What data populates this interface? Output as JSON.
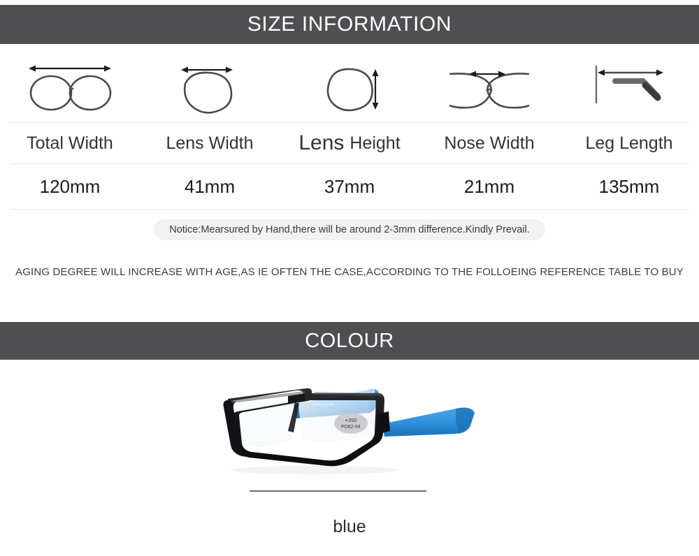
{
  "sections": {
    "size": {
      "banner_title": "SIZE INFORMATION",
      "columns": [
        {
          "icon": "total-width-icon",
          "label": "Total Width",
          "value": "120mm"
        },
        {
          "icon": "lens-width-icon",
          "label": "Lens Width",
          "value": "41mm"
        },
        {
          "icon": "lens-height-icon",
          "label_part1": "Lens",
          "label_part2": "Height",
          "label": "Lens Height",
          "value": "37mm"
        },
        {
          "icon": "nose-width-icon",
          "label": "Nose Width",
          "value": "21mm"
        },
        {
          "icon": "leg-length-icon",
          "label": "Leg Length",
          "value": "135mm"
        }
      ],
      "notice": "Notice:Mearsured by Hand,there will be around 2-3mm difference.Kindly Prevail.",
      "aging_note": "AGING DEGREE WILL INCREASE WITH AGE,AS IE OFTEN THE CASE,ACCORDING TO THE FOLLOEING REFERENCE TABLE TO BUY"
    },
    "colour": {
      "banner_title": "COLOUR",
      "product_image": "eyeglasses-photo",
      "lens_sticker_line1": "+350",
      "lens_sticker_line2": "PD62-64",
      "swatch_name": "blue"
    }
  },
  "colors": {
    "banner_background": "#4f4f51",
    "banner_text": "#ffffff",
    "rule": "#e6e6e6",
    "notice_background": "#f2f2f2",
    "frame_black": "#16161a",
    "temple_blue": "#2f8fdc",
    "divider": "#6e6e70"
  }
}
